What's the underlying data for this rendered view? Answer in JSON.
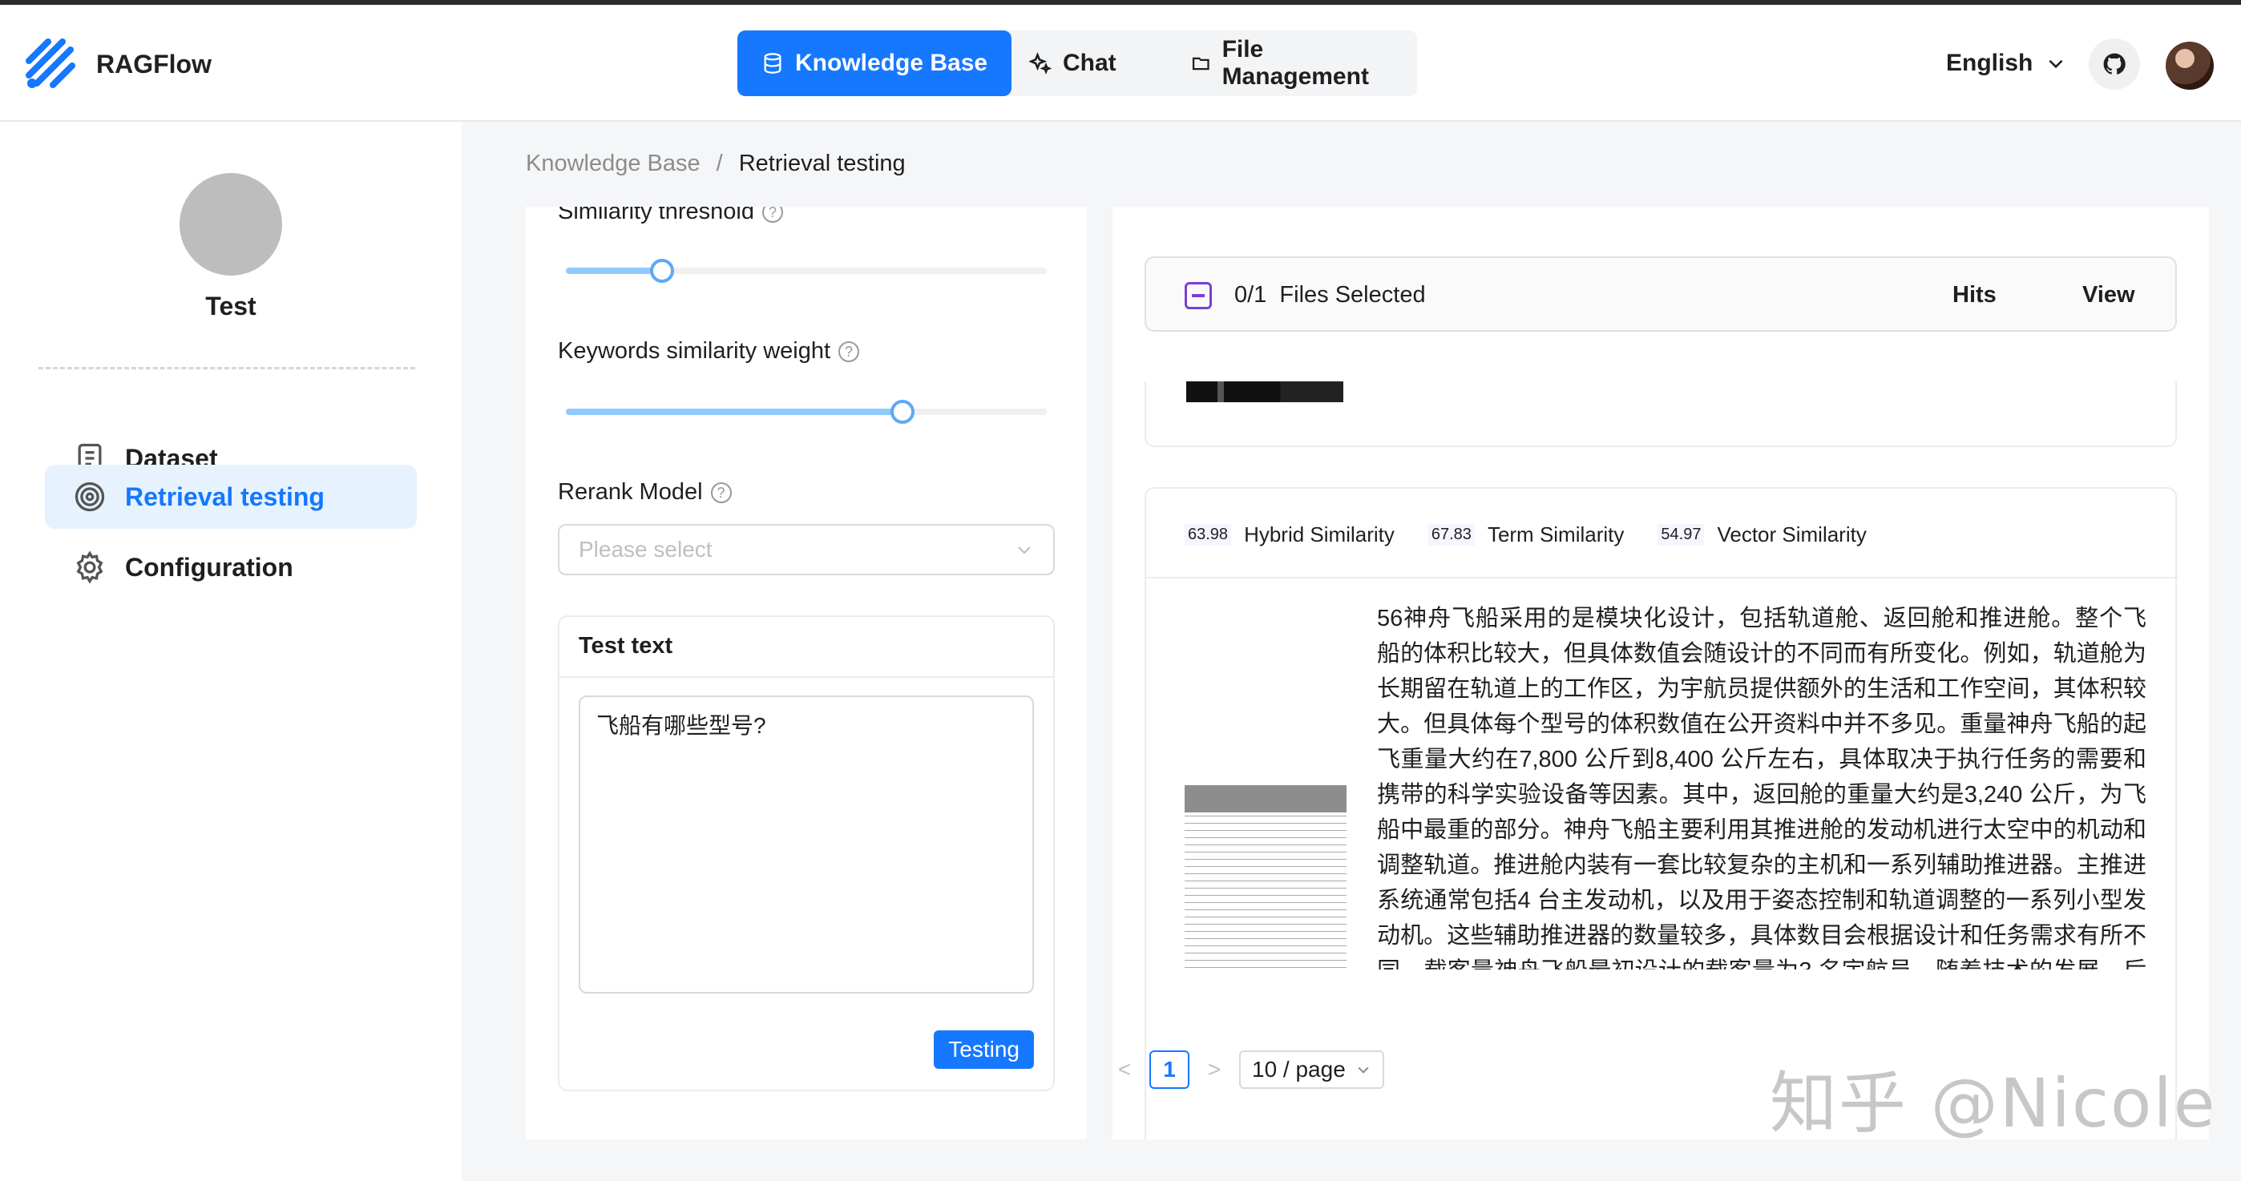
{
  "header": {
    "brand": "RAGFlow",
    "nav": [
      {
        "label": "Knowledge Base",
        "icon": "database-icon",
        "active": true
      },
      {
        "label": "Chat",
        "icon": "sparkle-icon",
        "active": false
      },
      {
        "label": "File Management",
        "icon": "folder-icon",
        "active": false
      }
    ],
    "language": "English",
    "accent_color": "#1677ff"
  },
  "sidebar": {
    "kb_name": "Test",
    "items": [
      {
        "label": "Dataset",
        "icon": "document-icon",
        "active": false
      },
      {
        "label": "Retrieval testing",
        "icon": "target-icon",
        "active": true
      },
      {
        "label": "Configuration",
        "icon": "gear-icon",
        "active": false
      }
    ]
  },
  "breadcrumb": {
    "root": "Knowledge Base",
    "separator": "/",
    "current": "Retrieval testing"
  },
  "settings": {
    "similarity_threshold": {
      "label": "Similarity threshold",
      "value": 0.2
    },
    "keywords_weight": {
      "label": "Keywords similarity weight",
      "value": 0.7
    },
    "rerank": {
      "label": "Rerank Model",
      "placeholder": "Please select"
    },
    "test_text": {
      "title": "Test text",
      "value": "飞船有哪些型号?",
      "button": "Testing"
    }
  },
  "results": {
    "files_selected": "0/1  Files Selected",
    "hits_label": "Hits",
    "view_label": "View",
    "chunk": {
      "hybrid_score": "63.98",
      "hybrid_label": "Hybrid Similarity",
      "term_score": "67.83",
      "term_label": "Term Similarity",
      "vector_score": "54.97",
      "vector_label": "Vector Similarity",
      "text": "56神舟飞船采用的是模块化设计，包括轨道舱、返回舱和推进舱。整个飞船的体积比较大，但具体数值会随设计的不同而有所变化。例如，轨道舱为长期留在轨道上的工作区，为宇航员提供额外的生活和工作空间，其体积较大。但具体每个型号的体积数值在公开资料中并不多见。重量神舟飞船的起飞重量大约在7,800 公斤到8,400 公斤左右，具体取决于执行任务的需要和携带的科学实验设备等因素。其中，返回舱的重量大约是3,240 公斤，为飞船中最重的部分。神舟飞船主要利用其推进舱的发动机进行太空中的机动和调整轨道。推进舱内装有一套比较复杂的主机和一系列辅助推进器。主推进系统通常包括4 台主发动机，以及用于姿态控制和轨道调整的一系列小型发动机。这些辅助推进器的数量较多，具体数目会根据设计和任务需求有所不同。载客量神舟飞船最初设计的载客量为3 名宇航员。随着技术的发展，后续型号可能在这一基础上"
    }
  },
  "pagination": {
    "prev": "<",
    "current_page": "1",
    "next": ">",
    "page_size": "10 / page"
  },
  "watermark": "知乎 @Nicole"
}
